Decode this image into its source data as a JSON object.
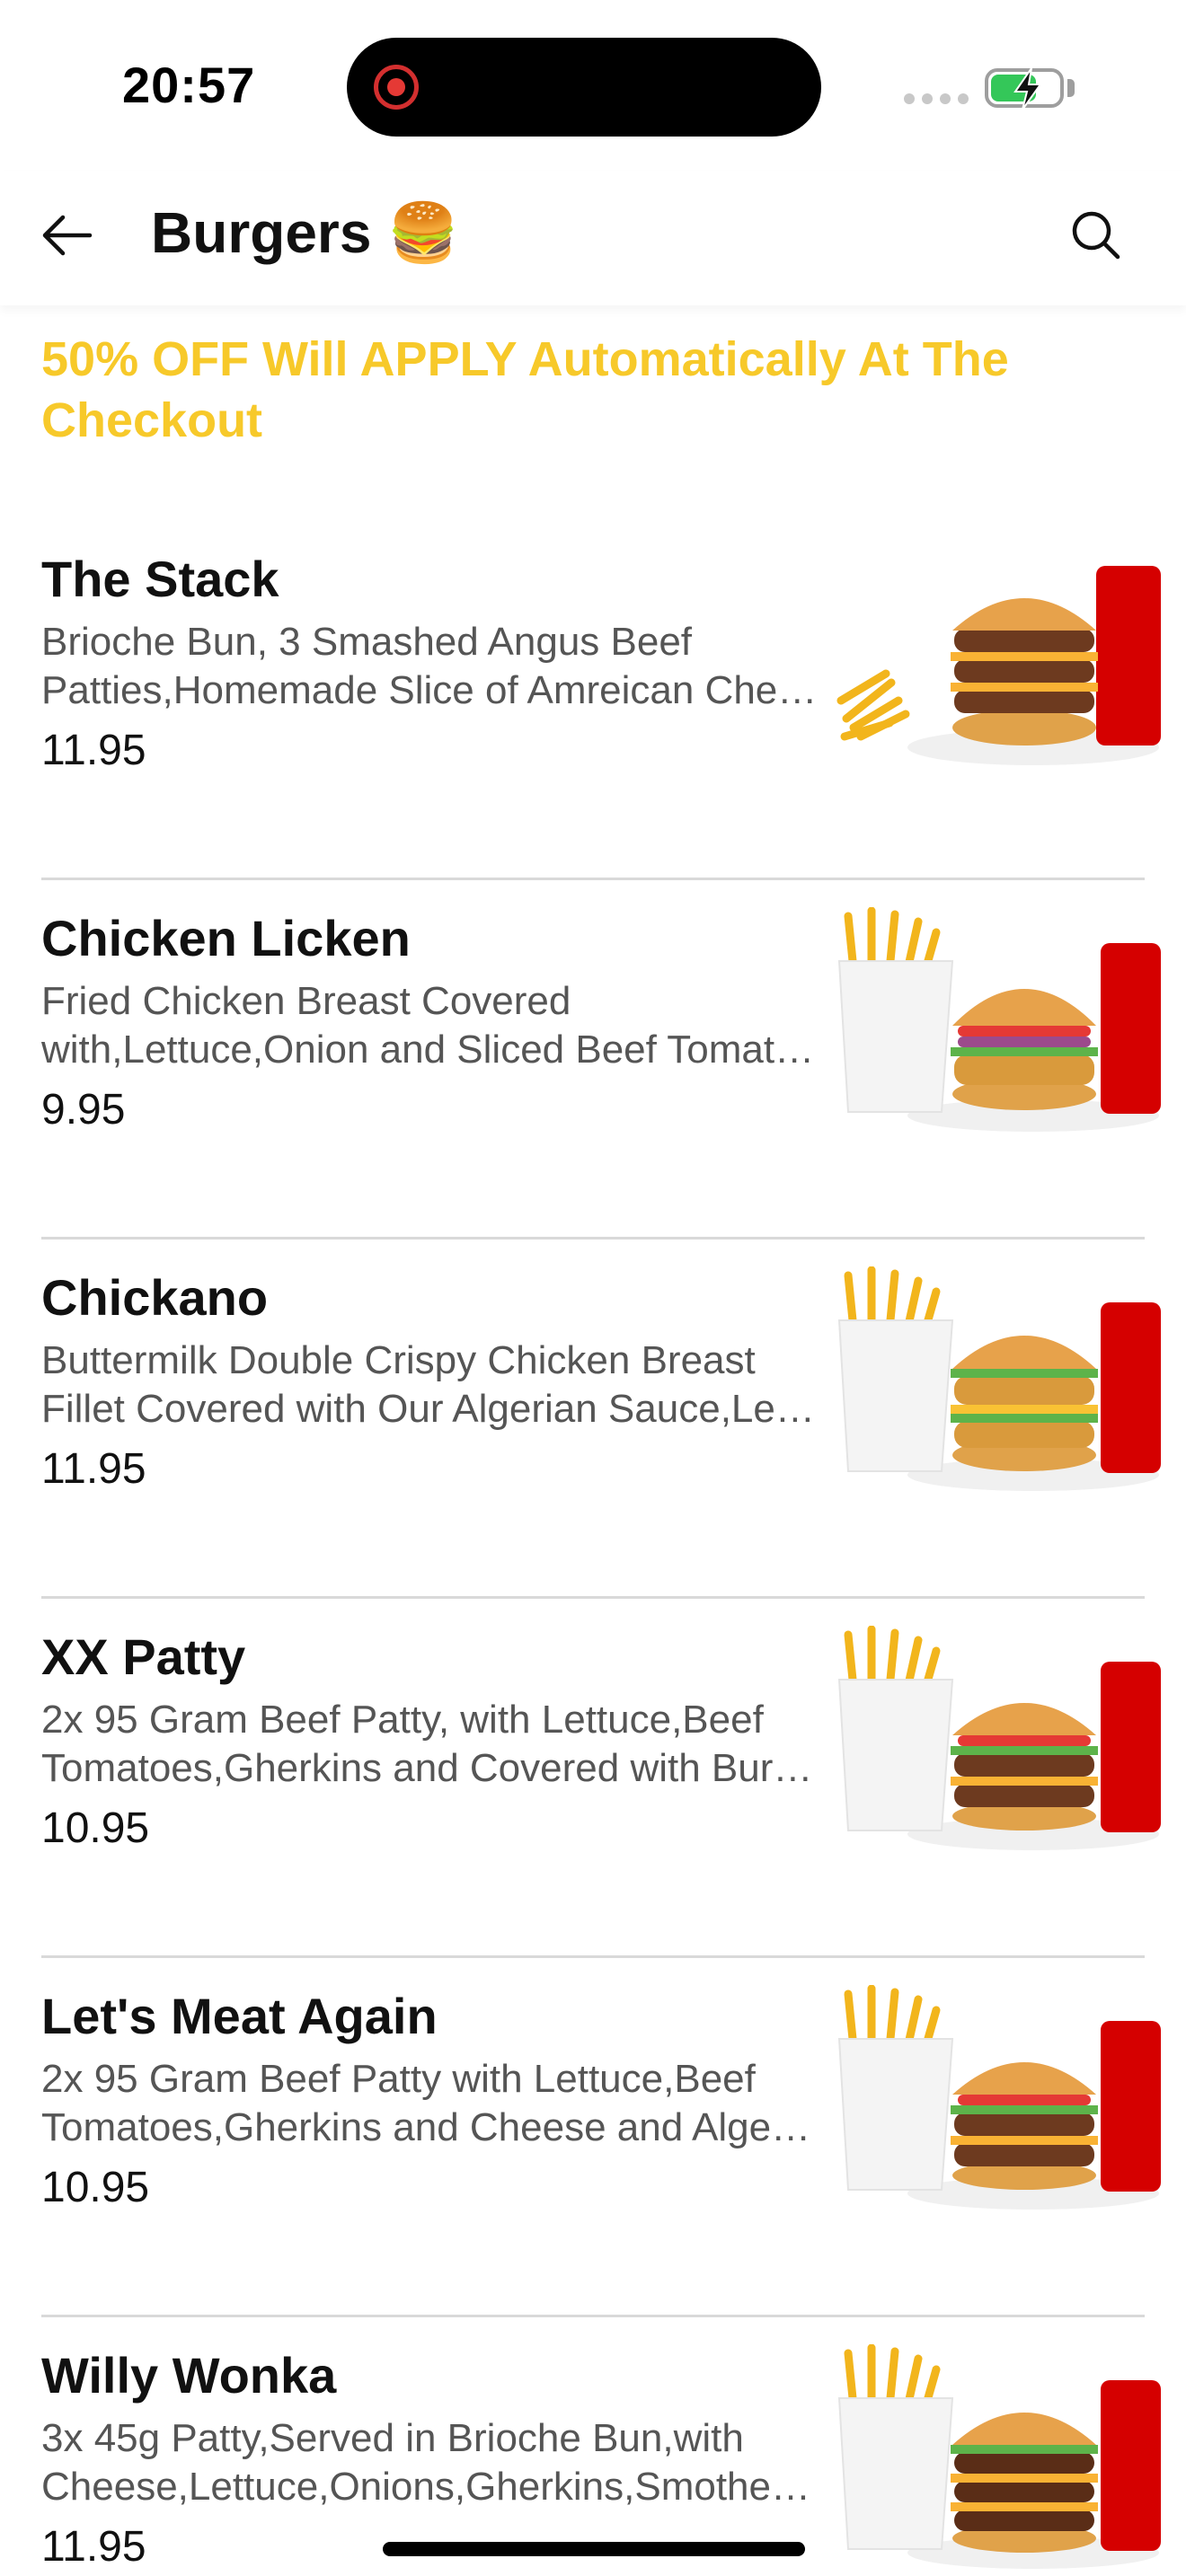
{
  "status_bar": {
    "time": "20:57"
  },
  "header": {
    "title": "Burgers 🍔"
  },
  "promo_text": "50% OFF Will APPLY Automatically At The Checkout",
  "items": [
    {
      "name": "The Stack",
      "desc_line1": "Brioche Bun, 3 Smashed Angus Beef",
      "desc_line2": "Patties,Homemade Slice of Amreican Che…",
      "price": "11.95"
    },
    {
      "name": "Chicken Licken",
      "desc_line1": "Fried Chicken Breast Covered",
      "desc_line2": "with,Lettuce,Onion and Sliced Beef Tomat…",
      "price": "9.95"
    },
    {
      "name": "Chickano",
      "desc_line1": "Buttermilk Double Crispy Chicken Breast",
      "desc_line2": "Fillet Covered with Our Algerian Sauce,Le…",
      "price": "11.95"
    },
    {
      "name": "XX Patty",
      "desc_line1": "2x 95 Gram Beef Patty, with Lettuce,Beef",
      "desc_line2": "Tomatoes,Gherkins and Covered with Bur…",
      "price": "10.95"
    },
    {
      "name": "Let's Meat Again",
      "desc_line1": "2x 95 Gram Beef Patty with Lettuce,Beef",
      "desc_line2": "Tomatoes,Gherkins and Cheese and Algeri…",
      "price": "10.95"
    },
    {
      "name": "Willy Wonka",
      "desc_line1": "3x 45g Patty,Served in Brioche Bun,with",
      "desc_line2": "Cheese,Lettuce,Onions,Gherkins,Smother…",
      "price": "11.95"
    }
  ],
  "colors": {
    "promo": "#f7c92a",
    "divider": "#d9d9d9",
    "battery": "#34c759"
  }
}
